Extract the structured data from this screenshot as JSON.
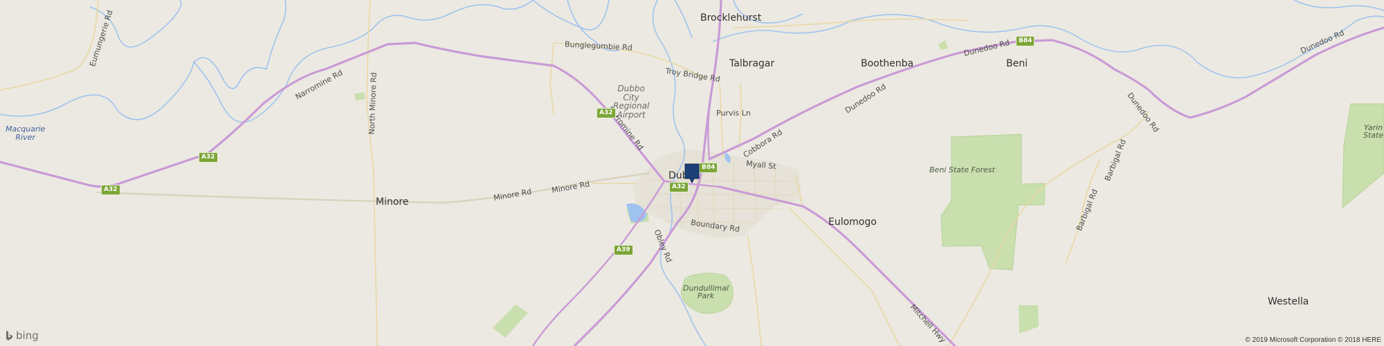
{
  "map": {
    "provider": "bing",
    "copyright": "© 2019 Microsoft Corporation © 2018 HERE",
    "places": {
      "brocklehurst": "Brocklehurst",
      "talbragar": "Talbragar",
      "boothenba": "Boothenba",
      "beni": "Beni",
      "dubbo": "Dubb",
      "minore": "Minore",
      "eulomogo": "Eulomogo",
      "westella": "Westella"
    },
    "roads": {
      "eumungerie": "Eumungerie Rd",
      "narromine_west": "Narromine Rd",
      "north_minore": "North Minore Rd",
      "bunglegumbie": "Bunglegumbie Rd",
      "troy_bridge": "Troy Bridge Rd",
      "purvis": "Purvis Ln",
      "narromine_city": "Narromine Rd",
      "cobbora": "Cobbora Rd",
      "dunedoo_a": "Dunedoo Rd",
      "dunedoo_b": "Dunedoo Rd",
      "dunedoo_east": "Dunedoo Rd",
      "dunedoo_south": "Dunedoo Rd",
      "myall": "Myall St",
      "minore_a": "Minore Rd",
      "minore_b": "Minore Rd",
      "boundary": "Boundary Rd",
      "obley": "Obley Rd",
      "mitchell": "Mitchell Hwy",
      "barbigal_a": "Barbigal Rd",
      "barbigal_b": "Barbigal Rd"
    },
    "shields": {
      "a32_west": "A32",
      "a32_mid": "A32",
      "a32_airport": "A32",
      "a32_city": "A32",
      "b84_city": "B84",
      "b84_east": "B84",
      "a39": "A39"
    },
    "features": {
      "airport": "Dubbo\nCity\nRegional\nAirport",
      "beni_forest": "Beni State Forest",
      "dundullimal": "Dundullimal\nPark",
      "yarin": "Yarin\nState",
      "macquarie": "Macquarie\nRiver"
    },
    "colors": {
      "land": "#ece9e2",
      "highway": "#c99ad6",
      "minor_road": "#e8d8a4",
      "river": "#9fc3ee",
      "park": "#c9dfae",
      "shield": "#7ca537",
      "pin": "#1d3f78"
    }
  }
}
